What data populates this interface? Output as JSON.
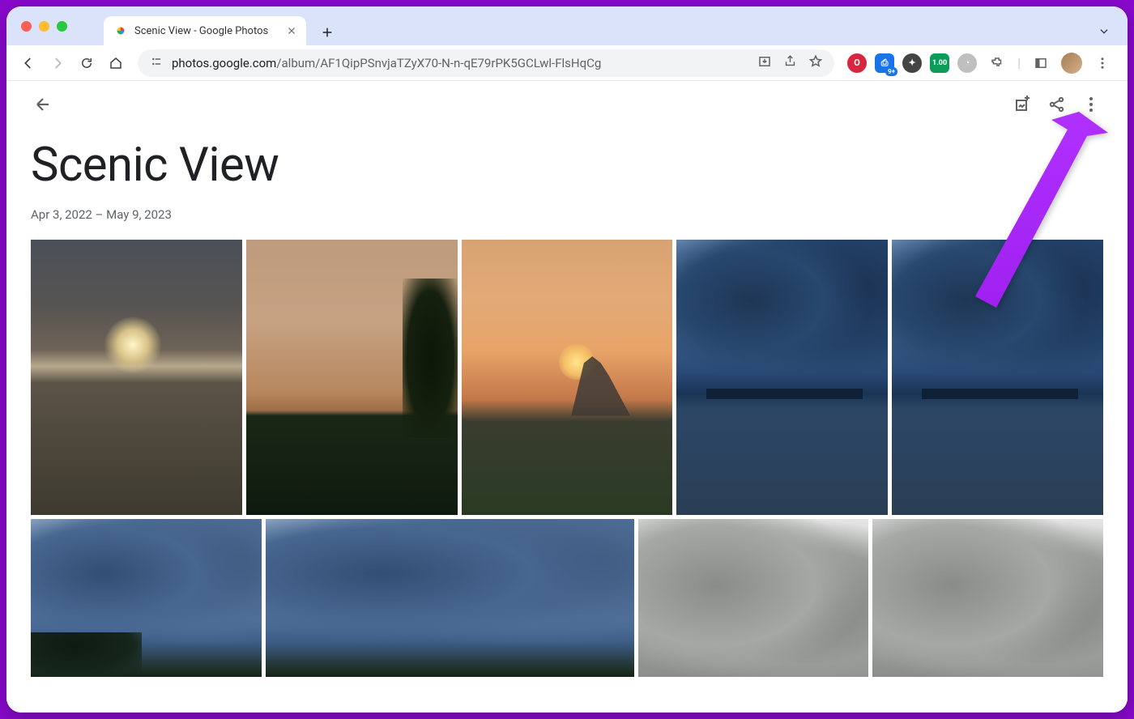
{
  "browser": {
    "tab_title": "Scenic View - Google Photos",
    "url_domain": "photos.google.com",
    "url_path": "/album/AF1QipPSnvjaTZyX70-N-n-qE79rPK5GCLwl-FlsHqCg",
    "ext_badge_cap": "9+",
    "ext_badge_green": "1.00"
  },
  "album": {
    "title": "Scenic View",
    "date_range": "Apr 3, 2022 – May 9, 2023"
  },
  "appbar": {
    "add_photos_label": "Add photos",
    "share_label": "Share",
    "more_label": "More options"
  },
  "annotation": {
    "arrow_target": "more-options-button",
    "arrow_color": "#a020f0"
  }
}
